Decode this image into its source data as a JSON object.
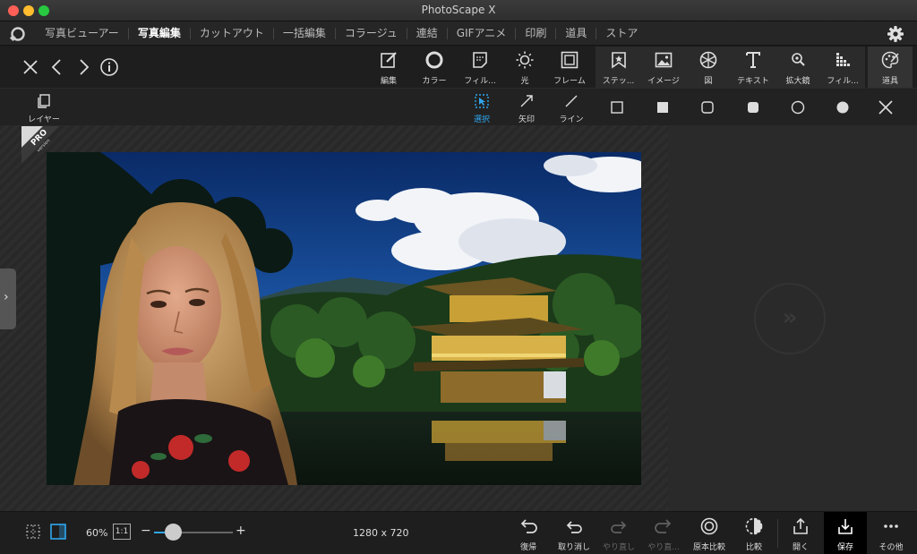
{
  "window": {
    "title": "PhotoScape X"
  },
  "nav": {
    "tabs": [
      {
        "label": "写真ビューアー"
      },
      {
        "label": "写真編集",
        "active": true
      },
      {
        "label": "カットアウト"
      },
      {
        "label": "一括編集"
      },
      {
        "label": "コラージュ"
      },
      {
        "label": "連結"
      },
      {
        "label": "GIFアニメ"
      },
      {
        "label": "印刷"
      },
      {
        "label": "道具"
      },
      {
        "label": "ストア"
      }
    ]
  },
  "tools": [
    {
      "label": "編集",
      "icon": "edit-icon"
    },
    {
      "label": "カラー",
      "icon": "color-icon"
    },
    {
      "label": "フィル...",
      "icon": "filter-icon"
    },
    {
      "label": "光",
      "icon": "light-icon"
    },
    {
      "label": "フレーム",
      "icon": "frame-icon"
    },
    {
      "label": "ステッ...",
      "icon": "sticker-icon"
    },
    {
      "label": "イメージ",
      "icon": "image-icon"
    },
    {
      "label": "図",
      "icon": "figure-icon"
    },
    {
      "label": "テキスト",
      "icon": "text-icon"
    },
    {
      "label": "拡大鏡",
      "icon": "magnifier-icon"
    },
    {
      "label": "フィル...",
      "icon": "fill-icon"
    },
    {
      "label": "道具",
      "icon": "tools-palette-icon"
    }
  ],
  "subtools": {
    "layer": "レイヤー",
    "select": "選択",
    "arrow": "矢印",
    "line": "ライン"
  },
  "pro_badge": {
    "text": "PRO",
    "subtext": "version"
  },
  "status": {
    "zoom": "60%",
    "one_to_one": "1:1",
    "zoom_fraction": 0.17,
    "dimensions": "1280 x 720"
  },
  "actions": [
    {
      "label": "復帰",
      "icon": "revert-icon"
    },
    {
      "label": "取り消し",
      "icon": "undo-icon"
    },
    {
      "label": "やり直し",
      "icon": "redo-icon",
      "disabled": true
    },
    {
      "label": "やり直...",
      "icon": "redo-all-icon",
      "disabled": true
    },
    {
      "label": "原本比較",
      "icon": "compare-original-icon"
    },
    {
      "label": "比較",
      "icon": "compare-icon"
    },
    {
      "label": "開く",
      "icon": "share-open-icon"
    },
    {
      "label": "保存",
      "icon": "save-icon"
    },
    {
      "label": "その他",
      "icon": "more-icon"
    }
  ],
  "colors": {
    "accent": "#2fa7ee",
    "background": "#1b1b1b"
  }
}
